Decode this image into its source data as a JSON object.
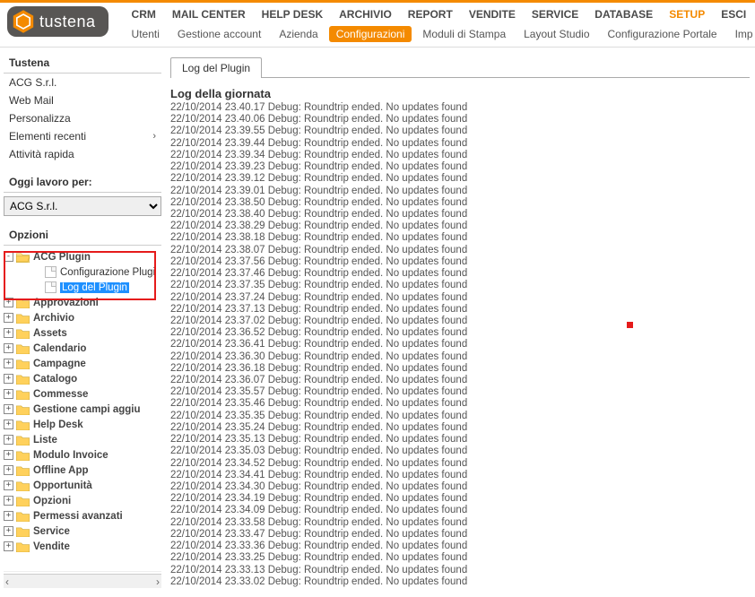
{
  "brand": "tustena",
  "main_nav": [
    {
      "label": "CRM"
    },
    {
      "label": "MAIL CENTER"
    },
    {
      "label": "HELP DESK"
    },
    {
      "label": "ARCHIVIO"
    },
    {
      "label": "REPORT"
    },
    {
      "label": "VENDITE"
    },
    {
      "label": "SERVICE"
    },
    {
      "label": "DATABASE"
    },
    {
      "label": "SETUP",
      "active": true
    },
    {
      "label": "ESCI"
    }
  ],
  "sub_nav": [
    {
      "label": "Utenti"
    },
    {
      "label": "Gestione account"
    },
    {
      "label": "Azienda"
    },
    {
      "label": "Configurazioni",
      "active": true
    },
    {
      "label": "Moduli di Stampa"
    },
    {
      "label": "Layout Studio"
    },
    {
      "label": "Configurazione Portale"
    },
    {
      "label": "Imp"
    }
  ],
  "side_panel1": {
    "title": "Tustena",
    "items": [
      "ACG S.r.l.",
      "Web Mail",
      "Personalizza",
      "Elementi recenti",
      "Attività rapida"
    ],
    "arrow_index": 3
  },
  "work_for": {
    "title": "Oggi lavoro per:",
    "value": "ACG S.r.l."
  },
  "options_title": "Opzioni",
  "tree": {
    "root": {
      "label": "ACG Plugin",
      "children": [
        "Configurazione Plugi",
        "Log del Plugin"
      ],
      "selected_child_index": 1
    },
    "folders": [
      "Approvazioni",
      "Archivio",
      "Assets",
      "Calendario",
      "Campagne",
      "Catalogo",
      "Commesse",
      "Gestione campi aggiu",
      "Help Desk",
      "Liste",
      "Modulo Invoice",
      "Offline App",
      "Opportunità",
      "Opzioni",
      "Permessi avanzati",
      "Service",
      "Vendite"
    ]
  },
  "tab_label": "Log del Plugin",
  "log_title": "Log della giornata",
  "log_lines": [
    "22/10/2014 23.40.17 Debug: Roundtrip ended. No updates found",
    "22/10/2014 23.40.06 Debug: Roundtrip ended. No updates found",
    "22/10/2014 23.39.55 Debug: Roundtrip ended. No updates found",
    "22/10/2014 23.39.44 Debug: Roundtrip ended. No updates found",
    "22/10/2014 23.39.34 Debug: Roundtrip ended. No updates found",
    "22/10/2014 23.39.23 Debug: Roundtrip ended. No updates found",
    "22/10/2014 23.39.12 Debug: Roundtrip ended. No updates found",
    "22/10/2014 23.39.01 Debug: Roundtrip ended. No updates found",
    "22/10/2014 23.38.50 Debug: Roundtrip ended. No updates found",
    "22/10/2014 23.38.40 Debug: Roundtrip ended. No updates found",
    "22/10/2014 23.38.29 Debug: Roundtrip ended. No updates found",
    "22/10/2014 23.38.18 Debug: Roundtrip ended. No updates found",
    "22/10/2014 23.38.07 Debug: Roundtrip ended. No updates found",
    "22/10/2014 23.37.56 Debug: Roundtrip ended. No updates found",
    "22/10/2014 23.37.46 Debug: Roundtrip ended. No updates found",
    "22/10/2014 23.37.35 Debug: Roundtrip ended. No updates found",
    "22/10/2014 23.37.24 Debug: Roundtrip ended. No updates found",
    "22/10/2014 23.37.13 Debug: Roundtrip ended. No updates found",
    "22/10/2014 23.37.02 Debug: Roundtrip ended. No updates found",
    "22/10/2014 23.36.52 Debug: Roundtrip ended. No updates found",
    "22/10/2014 23.36.41 Debug: Roundtrip ended. No updates found",
    "22/10/2014 23.36.30 Debug: Roundtrip ended. No updates found",
    "22/10/2014 23.36.18 Debug: Roundtrip ended. No updates found",
    "22/10/2014 23.36.07 Debug: Roundtrip ended. No updates found",
    "22/10/2014 23.35.57 Debug: Roundtrip ended. No updates found",
    "22/10/2014 23.35.46 Debug: Roundtrip ended. No updates found",
    "22/10/2014 23.35.35 Debug: Roundtrip ended. No updates found",
    "22/10/2014 23.35.24 Debug: Roundtrip ended. No updates found",
    "22/10/2014 23.35.13 Debug: Roundtrip ended. No updates found",
    "22/10/2014 23.35.03 Debug: Roundtrip ended. No updates found",
    "22/10/2014 23.34.52 Debug: Roundtrip ended. No updates found",
    "22/10/2014 23.34.41 Debug: Roundtrip ended. No updates found",
    "22/10/2014 23.34.30 Debug: Roundtrip ended. No updates found",
    "22/10/2014 23.34.19 Debug: Roundtrip ended. No updates found",
    "22/10/2014 23.34.09 Debug: Roundtrip ended. No updates found",
    "22/10/2014 23.33.58 Debug: Roundtrip ended. No updates found",
    "22/10/2014 23.33.47 Debug: Roundtrip ended. No updates found",
    "22/10/2014 23.33.36 Debug: Roundtrip ended. No updates found",
    "22/10/2014 23.33.25 Debug: Roundtrip ended. No updates found",
    "22/10/2014 23.33.13 Debug: Roundtrip ended. No updates found",
    "22/10/2014 23.33.02 Debug: Roundtrip ended. No updates found"
  ]
}
